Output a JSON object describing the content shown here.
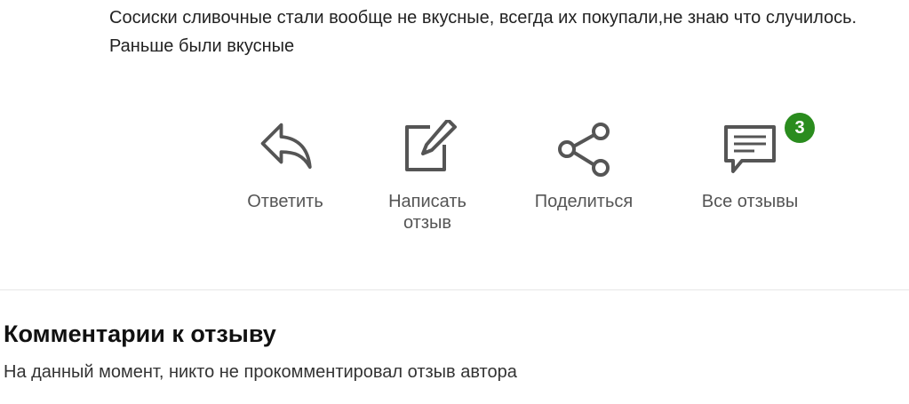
{
  "review": {
    "text": "Сосиски сливочные стали вообще не вкусные, всегда их покупали,не знаю что случилось. Раньше были вкусные"
  },
  "actions": {
    "reply": {
      "label": "Ответить",
      "icon": "reply-icon"
    },
    "write_review": {
      "label": "Написать отзыв",
      "icon": "edit-icon"
    },
    "share": {
      "label": "Поделиться",
      "icon": "share-icon"
    },
    "all_reviews": {
      "label": "Все отзывы",
      "icon": "comments-icon",
      "badge": "3"
    }
  },
  "colors": {
    "icon": "#555555",
    "badge": "#2a8c1e",
    "divider": "#e6e6e6"
  },
  "comments": {
    "title": "Комментарии к отзыву",
    "empty_text": "На данный момент, никто не прокомментировал отзыв автора"
  }
}
